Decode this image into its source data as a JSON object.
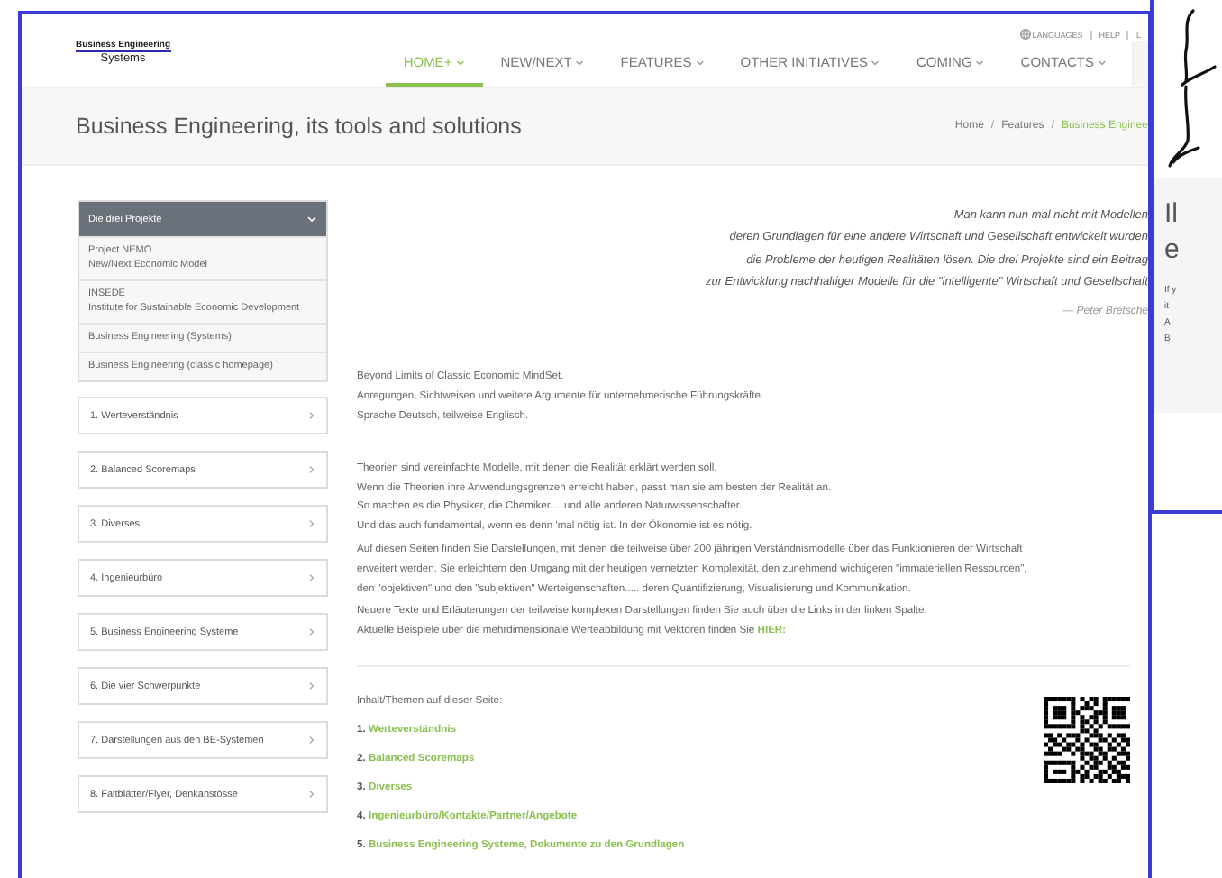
{
  "logo": {
    "line1": "Business Engineering",
    "line2": "Systems"
  },
  "top_links": [
    {
      "label": "LANGUAGES",
      "kind": "globe"
    },
    {
      "label": "HELP",
      "kind": "plain"
    },
    {
      "label": "L",
      "kind": "plain"
    }
  ],
  "nav": [
    {
      "label": "HOME+",
      "selected": true
    },
    {
      "label": "NEW/NEXT",
      "selected": false
    },
    {
      "label": "FEATURES",
      "selected": false
    },
    {
      "label": "OTHER INITIATIVES",
      "selected": false
    },
    {
      "label": "COMING",
      "selected": false
    },
    {
      "label": "CONTACTS",
      "selected": false
    }
  ],
  "page_title": "Business Engineering, its tools and solutions",
  "breadcrumb": [
    {
      "kind": "link",
      "label": "Home",
      "selected": false
    },
    {
      "kind": "separator",
      "label": "/"
    },
    {
      "kind": "link",
      "label": "Features",
      "selected": false
    },
    {
      "kind": "separator",
      "label": "/"
    },
    {
      "kind": "link",
      "label": "Business Enginee",
      "selected": true
    }
  ],
  "sidebar": {
    "group": {
      "title": "Die drei Projekte",
      "expanded": true,
      "items": [
        {
          "lines": [
            "Project NEMO",
            "New/Next Economic Model"
          ]
        },
        {
          "lines": [
            "INSEDE",
            "Institute for Sustainable Economic Development"
          ]
        },
        {
          "lines": [
            "Business Engineering (Systems)"
          ]
        },
        {
          "lines": [
            "Business Engineering (classic homepage)"
          ]
        }
      ]
    },
    "items": [
      "1. Werteverständnis",
      "2. Balanced Scoremaps",
      "3. Diverses",
      "4. Ingenieurbüro",
      "5. Business Engineering Systeme",
      "6. Die vier Schwerpunkte",
      "7. Darstellungen aus den BE-Systemen",
      "8. Faltblätter/Flyer, Denkanstösse"
    ]
  },
  "quote": {
    "lines": [
      "Man kann nun mal nicht mit Modellen",
      "deren Grundlagen für eine andere Wirtschaft und Gesellschaft entwickelt wurden",
      "die Probleme der heutigen Realitäten lösen. Die drei Projekte sind ein Beitrag",
      "zur Entwicklung nachhaltiger Modelle für die \"intelligente\" Wirtschaft und Gesellschaft"
    ],
    "author": "— Peter Bretsche"
  },
  "paragraphs": [
    {
      "lines": [
        "Beyond Limits of Classic Economic MindSet.",
        "Anregungen, Sichtweisen und weitere Argumente für unternehmerische Führungskräfte.",
        "Sprache Deutsch, teilweise Englisch."
      ]
    },
    {
      "lines": [
        "Theorien sind vereinfachte Modelle, mit denen die Realität erklärt werden soll.",
        "Wenn die Theorien ihre Anwendungsgrenzen erreicht haben, passt man sie am besten der Realität an.",
        "So machen es die Physiker, die Chemiker.... und alle anderen Naturwissenschafter.",
        "Und das auch fundamental, wenn es denn 'mal nötig ist. In der Ökonomie ist es nötig."
      ]
    },
    {
      "lines": [
        "Auf diesen Seiten finden Sie Darstellungen, mit denen die teilweise über 200 jährigen Verständnismodelle über das Funktionieren der Wirtschaft",
        "erweitert werden. Sie erleichtern den Umgang mit der heutigen vernetzten Komplexität, den zunehmend wichtigeren \"immateriellen Ressourcen\",",
        "den \"objektiven\" und den \"subjektiven\" Werteigenschaften..... deren Quantifizierung, Visualisierung und Kommunikation."
      ]
    },
    {
      "lines": [
        "Neuere Texte und Erläuterungen der teilweise komplexen Darstellungen finden Sie auch über die Links in der linken Spalte.",
        "Aktuelle Beispiele über die mehrdimensionale Werteabbildung mit Vektoren finden Sie"
      ],
      "link": "HIER:"
    }
  ],
  "contents": {
    "title": "Inhalt/Themen auf dieser Seite:",
    "items": [
      {
        "number": "1.",
        "label": "Werteverständnis"
      },
      {
        "number": "2.",
        "label": "Balanced Scoremaps"
      },
      {
        "number": "3.",
        "label": "Diverses"
      },
      {
        "number": "4.",
        "label": "Ingenieurbüro/Kontakte/Partner/Angebote"
      },
      {
        "number": "5.",
        "label": "Business Engineering Systeme, Dokumente zu den Grundlagen"
      }
    ]
  },
  "overlay": {
    "heading_lines": [
      "Il",
      "e"
    ],
    "text_lines": [
      "If y",
      "it -",
      "A",
      "B"
    ]
  }
}
